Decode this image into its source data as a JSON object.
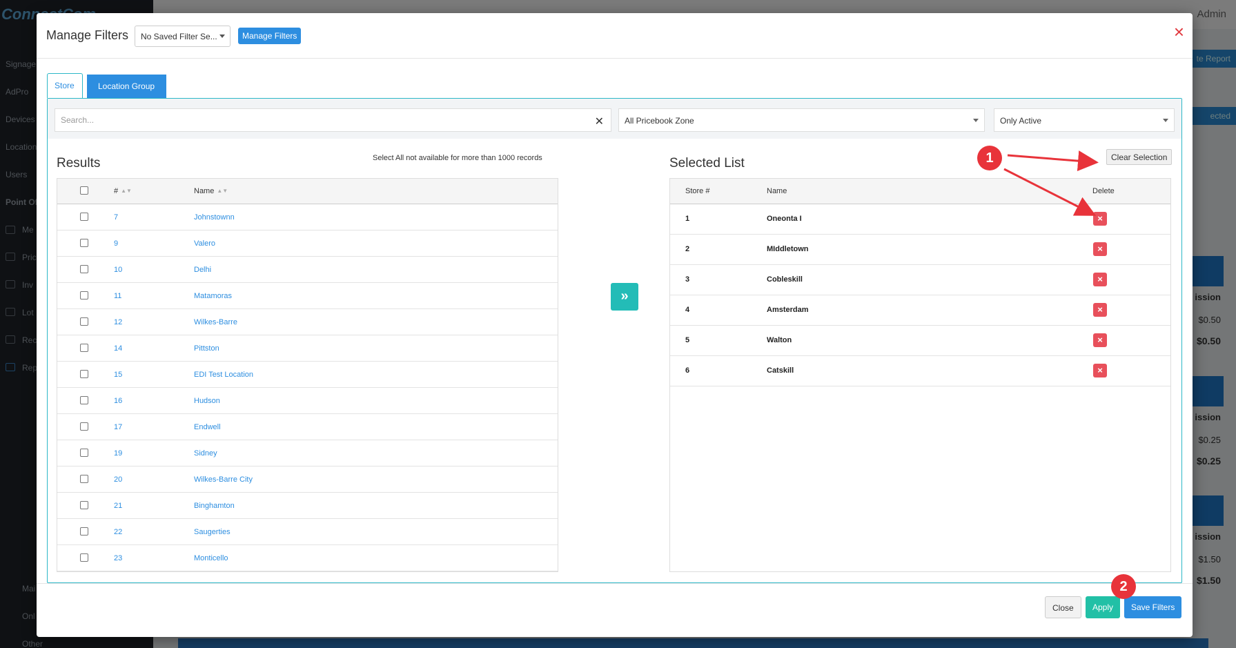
{
  "background": {
    "logo": "ConnectCom",
    "admin_label": "Admin",
    "report_button": "te Report",
    "selected_button": "ected",
    "sidebar_items": [
      "Signage",
      "AdPro",
      "Devices",
      "Location",
      "Users",
      "Point Of",
      "Me",
      "Pric",
      "Inv",
      "Lot",
      "Rec",
      "Rep",
      "Mai",
      "Onl",
      "Other"
    ],
    "values": {
      "col_header_1": "ission",
      "v1": "$0.50",
      "v1_bold": "$0.50",
      "col_header_2": "ission",
      "v2": "$0.25",
      "v2_bold": "$0.25",
      "col_header_3": "ission",
      "v3": "$1.50",
      "v3_bold": "$1.50"
    }
  },
  "modal": {
    "title": "Manage Filters",
    "saved_filter_select": "No Saved Filter Se...",
    "manage_filters_button": "Manage Filters",
    "close_icon": "×"
  },
  "tabs": [
    {
      "label": "Store",
      "active": true
    },
    {
      "label": "Location Group",
      "active": false
    }
  ],
  "filters": {
    "search_placeholder": "Search...",
    "pricebook_zone": "All Pricebook Zone",
    "status": "Only Active"
  },
  "results": {
    "title": "Results",
    "note": "Select All not available for more than 1000 records",
    "columns": {
      "number": "#",
      "name": "Name"
    },
    "rows": [
      {
        "num": "7",
        "name": "Johnstownn"
      },
      {
        "num": "9",
        "name": "Valero"
      },
      {
        "num": "10",
        "name": "Delhi"
      },
      {
        "num": "11",
        "name": "Matamoras"
      },
      {
        "num": "12",
        "name": "Wilkes-Barre"
      },
      {
        "num": "14",
        "name": "Pittston"
      },
      {
        "num": "15",
        "name": "EDI Test Location"
      },
      {
        "num": "16",
        "name": "Hudson"
      },
      {
        "num": "17",
        "name": "Endwell"
      },
      {
        "num": "19",
        "name": "Sidney"
      },
      {
        "num": "20",
        "name": "Wilkes-Barre City"
      },
      {
        "num": "21",
        "name": "Binghamton"
      },
      {
        "num": "22",
        "name": "Saugerties"
      },
      {
        "num": "23",
        "name": "Monticello"
      }
    ]
  },
  "move_button_icon": "»",
  "selected": {
    "title": "Selected List",
    "clear_button": "Clear Selection",
    "columns": {
      "store": "Store #",
      "name": "Name",
      "delete": "Delete"
    },
    "rows": [
      {
        "num": "1",
        "name": "Oneonta I"
      },
      {
        "num": "2",
        "name": "MIddletown"
      },
      {
        "num": "3",
        "name": "Cobleskill"
      },
      {
        "num": "4",
        "name": "Amsterdam"
      },
      {
        "num": "5",
        "name": "Walton"
      },
      {
        "num": "6",
        "name": "Catskill"
      }
    ],
    "delete_icon": "×"
  },
  "footer": {
    "close": "Close",
    "apply": "Apply",
    "save": "Save Filters"
  },
  "annotations": {
    "badge1": "1",
    "badge2": "2"
  },
  "colors": {
    "primary": "#2d8ee0",
    "teal": "#23bcb7",
    "danger": "#e8505b",
    "annotation": "#e8333a"
  }
}
